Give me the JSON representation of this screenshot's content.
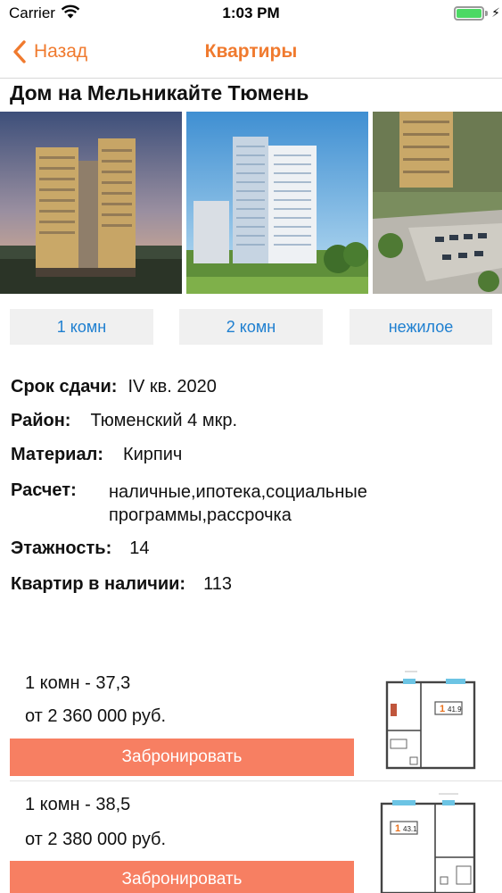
{
  "status_bar": {
    "carrier": "Carrier",
    "time": "1:03 PM"
  },
  "nav": {
    "back_label": "Назад",
    "title": "Квартиры"
  },
  "house": {
    "title": "Дом на Мельникайте Тюмень"
  },
  "room_tabs": [
    {
      "label": "1 комн"
    },
    {
      "label": "2 комн"
    },
    {
      "label": "нежилое"
    }
  ],
  "details": {
    "deadline": {
      "label": "Срок сдачи:",
      "value": "IV кв. 2020"
    },
    "district": {
      "label": "Район:",
      "value": "Тюменский 4 мкр."
    },
    "material": {
      "label": "Материал:",
      "value": "Кирпич"
    },
    "payment": {
      "label": "Расчет:",
      "value_line1": "наличные,ипотека,социальные",
      "value_line2": "программы,рассрочка"
    },
    "floors": {
      "label": "Этажность:",
      "value": "14"
    },
    "available": {
      "label": "Квартир в наличии:",
      "value": "113"
    }
  },
  "offers": [
    {
      "title": "1 комн - 37,3",
      "price": "от 2 360 000 руб.",
      "button": "Забронировать",
      "plan_rooms": "1",
      "plan_area": "41.9"
    },
    {
      "title": "1 комн - 38,5",
      "price": "от 2 380 000 руб.",
      "button": "Забронировать",
      "plan_rooms": "1",
      "plan_area": "43.1"
    }
  ],
  "colors": {
    "accent": "#f07a2e",
    "link": "#1e7fd0",
    "button": "#f77f62",
    "tab_bg": "#f0f0f0"
  }
}
